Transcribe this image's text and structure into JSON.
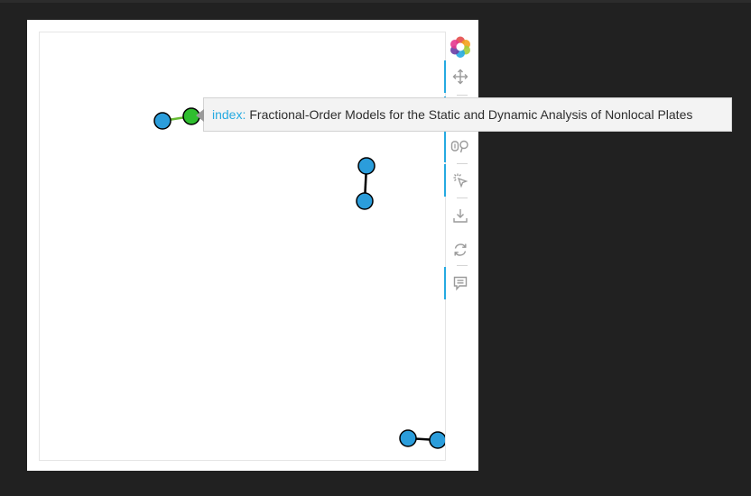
{
  "graph": {
    "node_fill": "#2b9ddb",
    "highlight_fill": "#2fbe2f",
    "node_stroke": "#000000",
    "edge_color": "#000000",
    "highlight_edge_color": "#66bb33"
  },
  "toolbar": {
    "accent_color": "#26aae1",
    "tools": [
      {
        "name": "logo-icon",
        "interactable": false
      },
      {
        "name": "pan-tool-icon",
        "active": true
      },
      {
        "name": "wheel-zoom-tool-icon",
        "active": true
      },
      {
        "name": "hover-tool-icon",
        "active": true
      },
      {
        "name": "tap-tool-icon",
        "active": true
      },
      {
        "name": "save-tool-icon",
        "active": false
      },
      {
        "name": "reset-tool-icon",
        "active": false
      },
      {
        "name": "comment-tool-icon",
        "active": true
      }
    ]
  },
  "tooltip": {
    "key": "index:",
    "value": "Fractional-Order Models for the Static and Dynamic Analysis of Nonlocal Plates"
  }
}
